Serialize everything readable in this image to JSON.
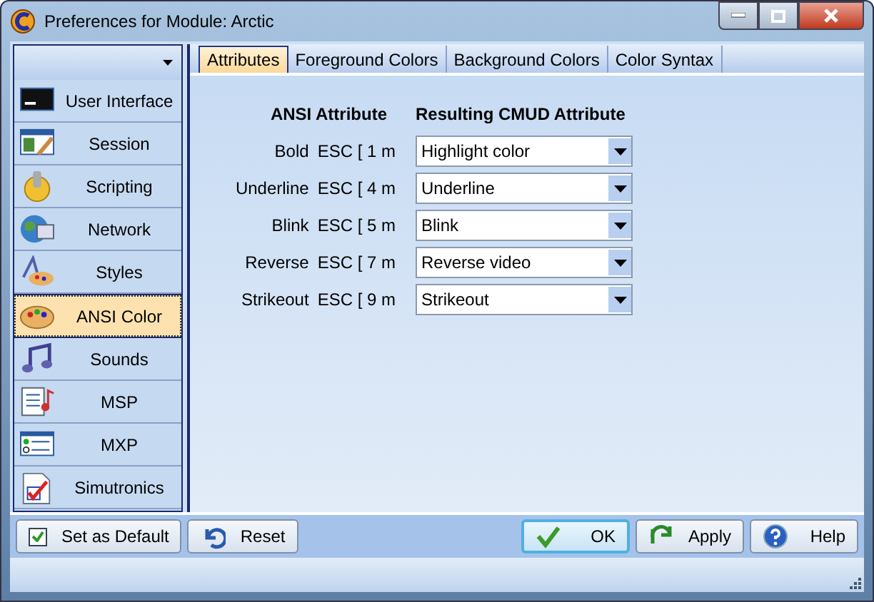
{
  "window": {
    "title": "Preferences for Module: Arctic"
  },
  "sidebar": {
    "items": [
      {
        "label": "User Interface",
        "selected": false
      },
      {
        "label": "Session",
        "selected": false
      },
      {
        "label": "Scripting",
        "selected": false
      },
      {
        "label": "Network",
        "selected": false
      },
      {
        "label": "Styles",
        "selected": false
      },
      {
        "label": "ANSI Color",
        "selected": true
      },
      {
        "label": "Sounds",
        "selected": false
      },
      {
        "label": "MSP",
        "selected": false
      },
      {
        "label": "MXP",
        "selected": false
      },
      {
        "label": "Simutronics",
        "selected": false
      }
    ]
  },
  "tabs": [
    {
      "label": "Attributes",
      "selected": true
    },
    {
      "label": "Foreground Colors",
      "selected": false
    },
    {
      "label": "Background Colors",
      "selected": false
    },
    {
      "label": "Color Syntax",
      "selected": false
    }
  ],
  "table": {
    "columns": [
      "ANSI Attribute",
      "Resulting CMUD Attribute"
    ],
    "rows": [
      {
        "attribute": "Bold",
        "code": "ESC [ 1 m",
        "value": "Highlight color"
      },
      {
        "attribute": "Underline",
        "code": "ESC [ 4 m",
        "value": "Underline"
      },
      {
        "attribute": "Blink",
        "code": "ESC [ 5 m",
        "value": "Blink"
      },
      {
        "attribute": "Reverse",
        "code": "ESC [ 7 m",
        "value": "Reverse video"
      },
      {
        "attribute": "Strikeout",
        "code": "ESC [ 9 m",
        "value": "Strikeout"
      }
    ]
  },
  "set_default": {
    "label": "Set as Default",
    "checked": true
  },
  "buttons": [
    {
      "label": "Reset",
      "kind": "reset",
      "default": false
    },
    {
      "label": "OK",
      "kind": "ok",
      "default": true
    },
    {
      "label": "Apply",
      "kind": "apply",
      "default": false
    },
    {
      "label": "Help",
      "kind": "help",
      "default": false
    }
  ]
}
